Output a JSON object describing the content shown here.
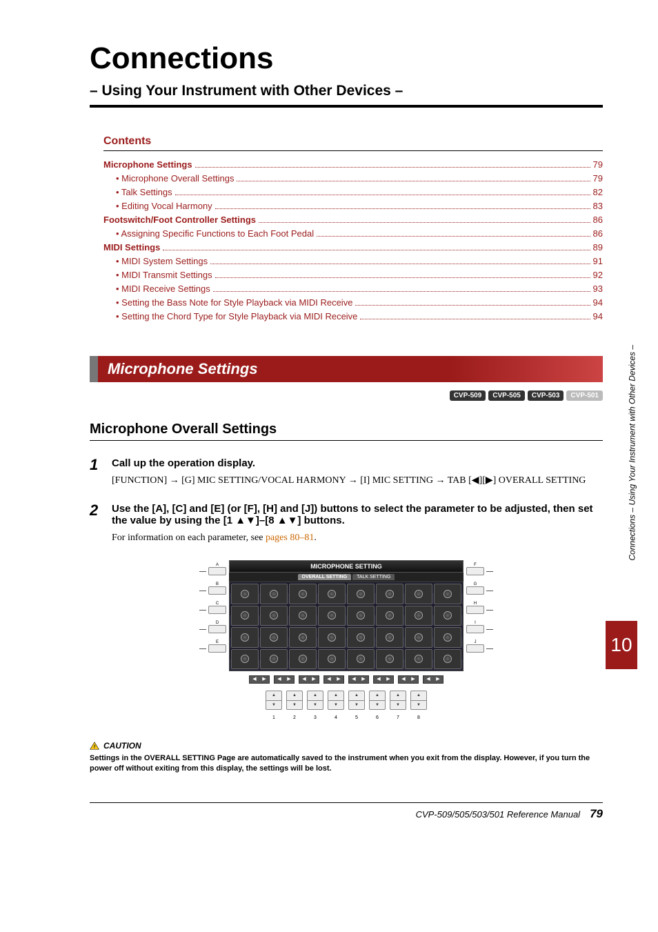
{
  "title": "Connections",
  "subtitle": "– Using Your Instrument with Other Devices –",
  "contents_heading": "Contents",
  "toc": [
    {
      "label": "Microphone Settings",
      "page": "79",
      "bold": true
    },
    {
      "label": "• Microphone Overall Settings",
      "page": "79",
      "sub": true
    },
    {
      "label": "• Talk Settings",
      "page": "82",
      "sub": true
    },
    {
      "label": "• Editing Vocal Harmony",
      "page": "83",
      "sub": true
    },
    {
      "label": "Footswitch/Foot Controller Settings",
      "page": "86",
      "bold": true
    },
    {
      "label": "• Assigning Specific Functions to Each Foot Pedal",
      "page": "86",
      "sub": true
    },
    {
      "label": "MIDI Settings",
      "page": "89",
      "bold": true
    },
    {
      "label": "• MIDI System Settings",
      "page": "91",
      "sub": true
    },
    {
      "label": "• MIDI Transmit Settings",
      "page": "92",
      "sub": true
    },
    {
      "label": "• MIDI Receive Settings",
      "page": "93",
      "sub": true
    },
    {
      "label": "• Setting the Bass Note for Style Playback via MIDI Receive",
      "page": "94",
      "sub": true
    },
    {
      "label": "• Setting the Chord Type for Style Playback via MIDI Receive",
      "page": "94",
      "sub": true
    }
  ],
  "section_title": "Microphone Settings",
  "chips": [
    {
      "label": "CVP-509",
      "dim": false
    },
    {
      "label": "CVP-505",
      "dim": false
    },
    {
      "label": "CVP-503",
      "dim": false
    },
    {
      "label": "CVP-501",
      "dim": true
    }
  ],
  "h2": "Microphone Overall Settings",
  "step1": {
    "num": "1",
    "title": "Call up the operation display.",
    "text": "[FUNCTION] → [G] MIC SETTING/VOCAL HARMONY → [I] MIC SETTING → TAB [◀][▶] OVERALL SETTING"
  },
  "step2": {
    "num": "2",
    "title": "Use the [A], [C] and [E] (or [F], [H] and [J]) buttons to select the parameter to be adjusted, then set the value by using the [1 ▲▼]–[8 ▲▼] buttons.",
    "text_pre": "For information on each parameter, see ",
    "text_link": "pages 80–81",
    "text_post": "."
  },
  "screenshot": {
    "title": "MICROPHONE SETTING",
    "tab_active": "OVERALL SETTING",
    "tab_inactive": "TALK SETTING",
    "left_labels": [
      "A",
      "B",
      "C",
      "D",
      "E"
    ],
    "right_labels": [
      "F",
      "G",
      "H",
      "I",
      "J"
    ],
    "bottom_nums": [
      "1",
      "2",
      "3",
      "4",
      "5",
      "6",
      "7",
      "8"
    ]
  },
  "caution": {
    "head": "CAUTION",
    "text": "Settings in the OVERALL SETTING Page are automatically saved to the instrument when you exit from the display. However, if you turn the power off without exiting from this display, the settings will be lost."
  },
  "footer": {
    "manual": "CVP-509/505/503/501 Reference Manual",
    "page": "79"
  },
  "side_text": "Connections – Using Your Instrument with Other Devices –",
  "chapter_num": "10"
}
